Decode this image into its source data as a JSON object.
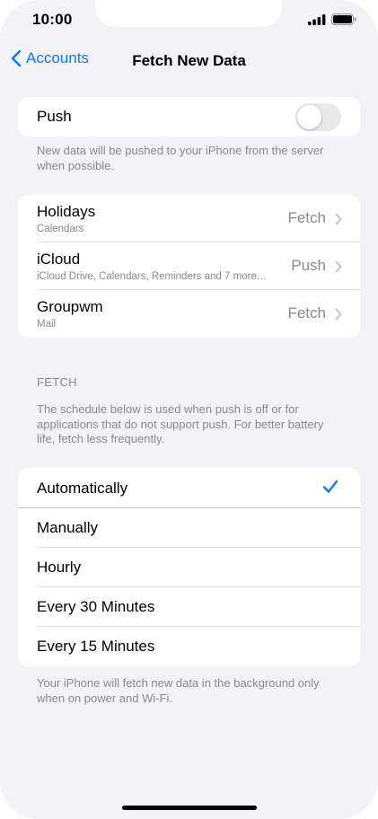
{
  "status": {
    "time": "10:00"
  },
  "nav": {
    "back_label": "Accounts",
    "title": "Fetch New Data"
  },
  "push": {
    "label": "Push",
    "enabled": false,
    "note": "New data will be pushed to your iPhone from the server when possible."
  },
  "accounts": [
    {
      "name": "Holidays",
      "subtitle": "Calendars",
      "value": "Fetch"
    },
    {
      "name": "iCloud",
      "subtitle": "iCloud Drive, Calendars, Reminders and 7 more…",
      "value": "Push"
    },
    {
      "name": "Groupwm",
      "subtitle": "Mail",
      "value": "Fetch"
    }
  ],
  "fetch": {
    "section_title": "FETCH",
    "note": "The schedule below is used when push is off or for applications that do not support push. For better battery life, fetch less frequently.",
    "options": [
      "Automatically",
      "Manually",
      "Hourly",
      "Every 30 Minutes",
      "Every 15 Minutes"
    ],
    "selected": "Automatically",
    "footer": "Your iPhone will fetch new data in the background only when on power and Wi-Fi."
  },
  "icons": [
    "signal-icon",
    "battery-icon",
    "chevron-left-icon",
    "chevron-right-icon",
    "checkmark-icon"
  ],
  "colors": {
    "accent": "#0a7aff",
    "background": "#f2f2f7",
    "secondary_text": "#8a8a8e"
  }
}
